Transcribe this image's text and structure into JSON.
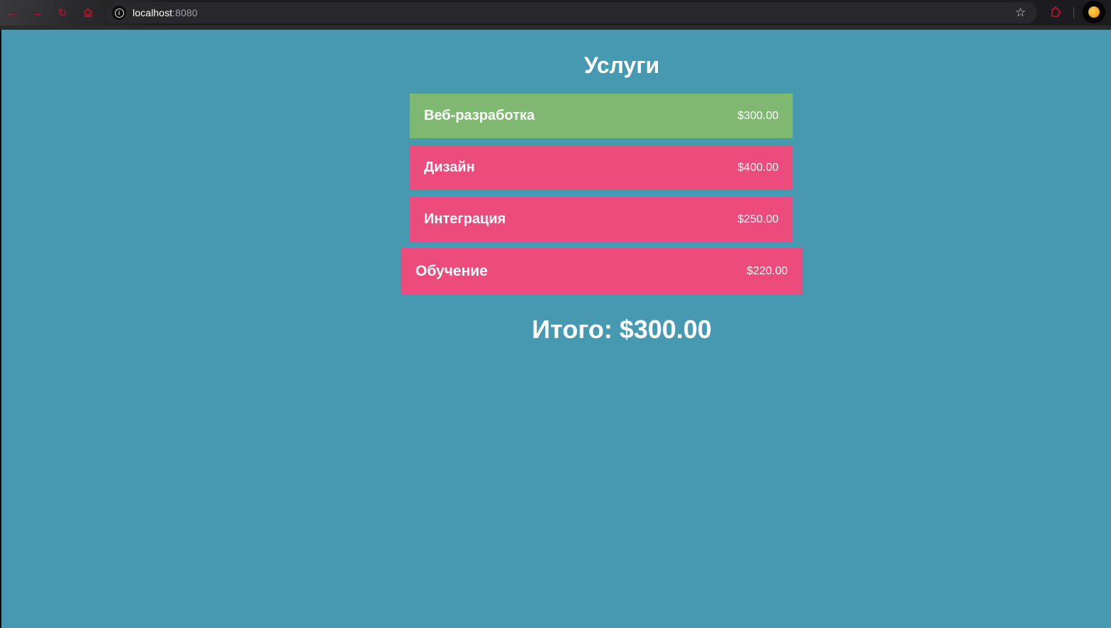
{
  "browser": {
    "url_host": "localhost",
    "url_port": ":8080",
    "icons": {
      "back": "arrow-left-icon",
      "forward": "arrow-right-icon",
      "reload": "reload-icon",
      "home": "home-icon",
      "site_info": "info-icon",
      "bookmark": "star-icon",
      "extensions": "puzzle-icon",
      "profile": "avatar"
    }
  },
  "page": {
    "title": "Услуги",
    "services": [
      {
        "name": "Веб-разработка",
        "price": "$300.00",
        "selected": true,
        "color": "#7fb870"
      },
      {
        "name": "Дизайн",
        "price": "$400.00",
        "selected": false,
        "color": "#ec4c7c"
      },
      {
        "name": "Интеграция",
        "price": "$250.00",
        "selected": false,
        "color": "#ec4c7c"
      },
      {
        "name": "Обучение",
        "price": "$220.00",
        "selected": false,
        "color": "#ec4c7c"
      }
    ],
    "total": "Итого: $300.00",
    "colors": {
      "background": "#4799b2",
      "selected": "#7fb870",
      "unselected": "#ec4c7c",
      "text": "#ffffff"
    }
  }
}
